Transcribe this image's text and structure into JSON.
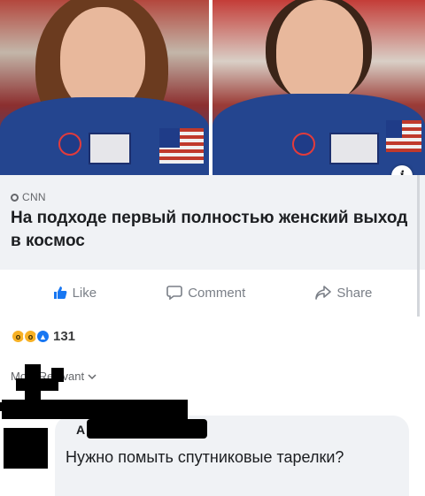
{
  "post": {
    "source": "CNN",
    "headline": "На подходе первый полностью женский выход в космос"
  },
  "actions": {
    "like": "Like",
    "comment": "Comment",
    "share": "Share"
  },
  "reactions": {
    "count": "131"
  },
  "sort": {
    "label": "Most Relevant"
  },
  "comment": {
    "author_initial": "A",
    "text": "Нужно помыть спутниковые тарелки?"
  },
  "colors": {
    "like_blue": "#1877f2",
    "muted_gray": "#7a7f87",
    "card_bg": "#f0f2f5"
  },
  "icons": [
    "info-icon",
    "thumbs-up-icon",
    "comment-icon",
    "share-icon",
    "chevron-down-icon"
  ]
}
